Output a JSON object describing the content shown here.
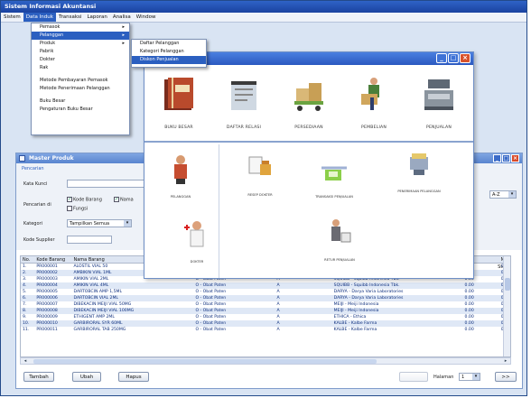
{
  "app": {
    "title": "Sistem Informasi Akuntansi"
  },
  "menubar": [
    "Sistem",
    "Data Induk",
    "Transaksi",
    "Laporan",
    "Analisa",
    "Window"
  ],
  "menubar_active": 1,
  "data_induk_menu": {
    "items": [
      "Pemasok",
      "Pelanggan",
      "Produk",
      "Pabrik",
      "Dokter",
      "Rak",
      "Metode Pembayaran Pemasok",
      "Metode Penerimaan Pelanggan",
      "Buku Besar",
      "Pengaturan Buku Besar"
    ],
    "highlighted": 1
  },
  "pelanggan_submenu": {
    "items": [
      "Daftar Pelanggan",
      "Kategori Pelanggan",
      "Diskon Penjualan"
    ],
    "highlighted": 2
  },
  "main_menu": {
    "modules": [
      "BUKU BESAR",
      "DAFTAR RELASI",
      "PERSEDIAAN",
      "PEMBELIAN",
      "PENJUALAN"
    ],
    "sub_modules": [
      "PELANGGAN",
      "RESEP DOKTER",
      "TRANSAKSI PENJUALAN",
      "PENERIMAAN PELANGGAN",
      "DOKTER",
      "RETUR PENJUALAN"
    ]
  },
  "master_produk": {
    "title": "Master Produk",
    "section_label": "Pencarian",
    "kata_kunci_label": "Kata Kunci",
    "pencarian_di_label": "Pencarian di",
    "cb_kode_barang": "Kode Barang",
    "cb_nama": "Nama",
    "cb_fungsi": "Fungsi",
    "kategori_label": "Kategori",
    "kategori_value": "Tampilkan Semua",
    "kode_supplier_label": "Kode Supplier",
    "sort_value": "A-Z",
    "columns": [
      "No.",
      "Kode Barang",
      "Nama Barang",
      "",
      "",
      "",
      "",
      "",
      "Max Stock"
    ],
    "rows": [
      [
        "1.",
        "PR000001",
        "ALOSTIL VIAL 50",
        "",
        "",
        "",
        "",
        "",
        "0.00"
      ],
      [
        "2.",
        "PR000002",
        "AMBIKIN VIAL 1ML",
        "",
        "",
        "",
        "",
        "",
        "0.00"
      ],
      [
        "3.",
        "PR000003",
        "AMIKIN VIAL 2ML",
        "O - Obat Paten",
        "A",
        "SQUIBB - Squibb Indonesia Tbk.",
        "0.00",
        "",
        "0.00"
      ],
      [
        "4.",
        "PR000004",
        "AMIKIN VIAL 4ML",
        "O - Obat Paten",
        "A",
        "SQUIBB - Squibb Indonesia Tbk.",
        "0.00",
        "",
        "0.00"
      ],
      [
        "5.",
        "PR000005",
        "DARTOBCIN AMP 1,5ML",
        "O - Obat Paten",
        "A",
        "DARYA - Darya Varia Laboratories",
        "0.00",
        "",
        "0.00"
      ],
      [
        "6.",
        "PR000006",
        "DARTOBCIN VIAL 2ML",
        "O - Obat Paten",
        "A",
        "DARYA - Darya Varia Laboratories",
        "0.00",
        "",
        "0.00"
      ],
      [
        "7.",
        "PR000007",
        "DIBEKACIN MEIJI VIAL 50MG",
        "O - Obat Paten",
        "A",
        "MEIJI - Meiji Indonesia",
        "0.00",
        "",
        "0.00"
      ],
      [
        "8.",
        "PR000008",
        "DIBEKACIN MEIJI VIAL 100MG",
        "O - Obat Paten",
        "A",
        "MEIJI - Meiji Indonesia",
        "0.00",
        "",
        "0.00"
      ],
      [
        "9.",
        "PR000009",
        "ETHIGENT AMP 2ML",
        "O - Obat Paten",
        "A",
        "ETHICA - Ethica",
        "0.00",
        "",
        "0.00"
      ],
      [
        "10.",
        "PR000010",
        "GARBIRORAL SYR 60ML",
        "O - Obat Paten",
        "A",
        "KALBE - Kalbe Farma",
        "0.00",
        "",
        "0.00"
      ],
      [
        "11.",
        "PR000011",
        "GARBIRORAL TAB 250MG",
        "O - Obat Paten",
        "A",
        "KALBE - Kalbe Farma",
        "0.00",
        "",
        "0.00"
      ]
    ],
    "buttons": {
      "tambah": "Tambah",
      "ubah": "Ubah",
      "hapus": "Hapus"
    },
    "halaman_label": "Halaman",
    "halaman_value": "1",
    "next_label": ">>"
  },
  "colors": {
    "title_blue": "#1a42a0",
    "highlight": "#2b5fc0",
    "close_red": "#d84a2a"
  }
}
